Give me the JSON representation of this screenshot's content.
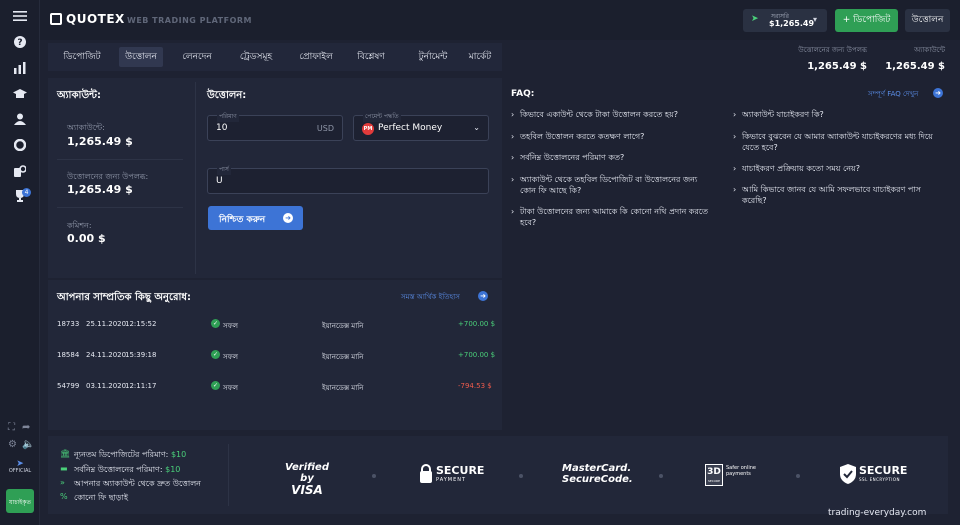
{
  "header": {
    "logo_text": "QUOTEX",
    "tagline": "WEB TRADING PLATFORM",
    "account_label": "সরাসরি",
    "account_value": "$1,265.49",
    "deposit_button": "+ ডিপোজিট",
    "withdraw_button": "উত্তোলন"
  },
  "tabs": [
    "ডিপোজিট",
    "উত্তোলন",
    "লেনদেন",
    "ট্রেডসমূহ",
    "প্রোফাইল",
    "বিশ্লেষণ",
    "টুর্নামেন্ট",
    "মার্কেট"
  ],
  "active_tab": "উত্তোলন",
  "balances": {
    "available_label": "উত্তোলনের জন্য উপলব্ধ",
    "available_value": "1,265.49 $",
    "account_label": "অ্যাকাউন্টে",
    "account_value": "1,265.49 $"
  },
  "account_panel": {
    "title": "অ্যাকাউন্ট:",
    "in_account_label": "অ্যাকাউন্টে:",
    "in_account_value": "1,265.49 $",
    "available_label": "উত্তোলনের জন্য উপলব্ধ:",
    "available_value": "1,265.49 $",
    "commission_label": "কমিশন:",
    "commission_value": "0.00 $"
  },
  "withdraw_form": {
    "title": "উত্তোলন:",
    "amount_label": "পরিমাণ",
    "amount_value": "10",
    "amount_currency": "USD",
    "payment_label": "পেমেন্ট পদ্ধতি",
    "payment_value": "Perfect Money",
    "payment_logo": "PM",
    "purse_label": "পার্স",
    "purse_value": "U",
    "confirm_button": "নিশ্চিত করুন"
  },
  "faq": {
    "title": "FAQ:",
    "link": "সম্পূর্ণ FAQ দেখুন",
    "left_items": [
      "কিভাবে একাউন্ট থেকে টাকা উত্তোলন করতে হয়?",
      "তহবিল উত্তোলন করতে কতক্ষণ লাগে?",
      "সর্বনিম্ন উত্তোলনের পরিমাণ কত?",
      "অ্যাকাউন্ট থেকে তহবিল ডিপোজিট বা উত্তোলনের জন্য কোন ফি আছে কি?",
      "টাকা উত্তোলনের জন্য আমাকে কি কোনো নথি প্রদান করতে হবে?"
    ],
    "right_items": [
      "অ্যাকাউন্ট যাচাইকরণ কি?",
      "কিভাবে বুঝবেন যে আমার অ্যাকাউন্ট যাচাইকরণের মধ্য দিয়ে যেতে হবে?",
      "যাচাইকরণ প্রক্রিয়ায় কতো সময় নেয়?",
      "আমি কিভাবে জানব যে আমি সফলভাবে যাচাইকরণ পাস করেছি?"
    ]
  },
  "requests": {
    "title": "আপনার সাম্প্রতিক কিছু অনুরোধ:",
    "link": "সমস্ত আর্থিক ইতিহাস",
    "rows": [
      {
        "id": "18733",
        "date": "25.11.2020",
        "time": "12:15:52",
        "status": "সফল",
        "method": "ইয়ানডেক্স মানি",
        "amount": "+700.00 $",
        "color": "#4ad07a"
      },
      {
        "id": "18584",
        "date": "24.11.2020",
        "time": "15:39:18",
        "status": "সফল",
        "method": "ইয়ানডেক্স মানি",
        "amount": "+700.00 $",
        "color": "#4ad07a"
      },
      {
        "id": "54799",
        "date": "03.11.2020",
        "time": "12:11:17",
        "status": "সফল",
        "method": "ইয়ানডেক্স মানি",
        "amount": "-794.53 $",
        "color": "#ef5b4c"
      }
    ]
  },
  "footer": {
    "features": [
      {
        "text": "ন্যূনতম ডিপোজিটের পরিমাণ:",
        "value": "$10"
      },
      {
        "text": "সর্বনিম্ন উত্তোলনের পরিমাণ:",
        "value": "$10"
      },
      {
        "text": "আপনার অ্যাকাউন্ট থেকে দ্রুত উত্তোলন",
        "value": ""
      },
      {
        "text": "কোনো ফি ছাড়াই",
        "value": ""
      }
    ],
    "visa_top": "Verified by",
    "visa_bottom": "VISA",
    "secure_payment_top": "SECURE",
    "secure_payment_bottom": "PAYMENT",
    "mastercard_top": "MasterCard.",
    "mastercard_bottom": "SecureCode.",
    "threed": "3D",
    "threed_sub": "SECURE",
    "threed_text": "Safer online payments",
    "ssl_top": "SECURE",
    "ssl_bottom": "SSL ENCRYPTION"
  },
  "sidebar": {
    "official_label": "OFFICIAL",
    "badge_text": "যাচাইকৃত",
    "notification_count": "4"
  },
  "watermark": "trading-everyday.com",
  "colors": {
    "accent_green": "#2f9f55",
    "accent_blue": "#3d74d6",
    "negative": "#ef5b4c",
    "positive": "#4ad07a"
  }
}
